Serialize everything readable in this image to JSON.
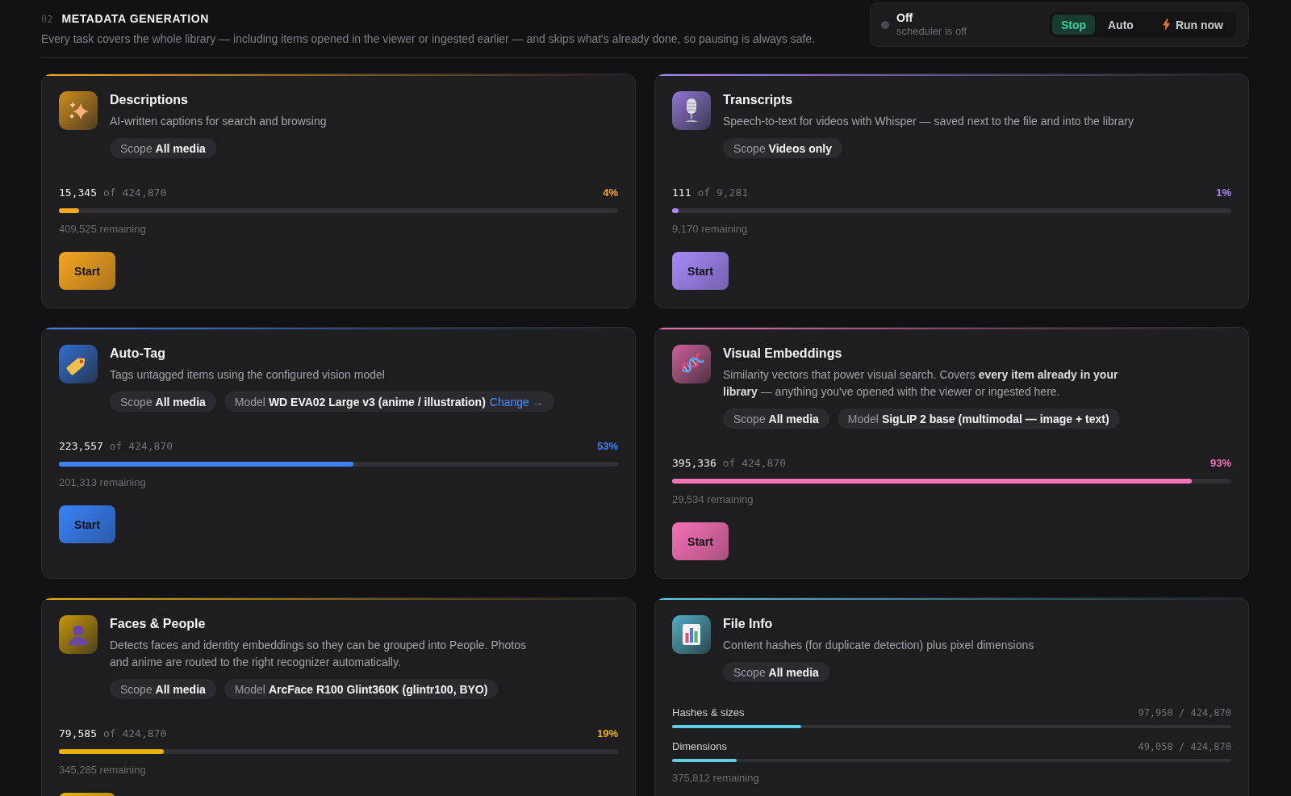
{
  "header": {
    "section_number": "02",
    "title": "METADATA GENERATION",
    "subtitle": "Every task covers the whole library — including items opened in the viewer or ingested earlier — and skips what's already done, so pausing is always safe."
  },
  "scheduler": {
    "on": false,
    "state": "Off",
    "detail": "scheduler is off",
    "modes": [
      {
        "label": "Stop",
        "selected": true
      },
      {
        "label": "Auto",
        "selected": false
      }
    ],
    "run_button": {
      "label": "Run now"
    }
  },
  "tasks": [
    {
      "kind": "progress",
      "title": "Descriptions",
      "color": "#f5a623",
      "description": "AI-written captions for search and browsing",
      "chips": [
        {
          "text": "Scope **All media**"
        }
      ],
      "progress": {
        "done": "15,345",
        "total": "of 424,870",
        "percent": "4%",
        "level": 0.036,
        "remaining": "409,525 remaining"
      },
      "button": {
        "kind": "primary",
        "label": "Start"
      }
    },
    {
      "kind": "progress",
      "title": "Transcripts",
      "color": "#a78bfa",
      "description": "Speech-to-text for videos with Whisper — saved next to the file and into the library",
      "chips": [
        {
          "text": "Scope **Videos only**"
        }
      ],
      "progress": {
        "done": "111",
        "total": "of 9,281",
        "percent": "1%",
        "level": 0.012,
        "remaining": "9,170 remaining"
      },
      "button": {
        "kind": "primary",
        "label": "Start"
      }
    },
    {
      "kind": "progress",
      "title": "Auto-Tag",
      "color": "#3b82f6",
      "description": "Tags untagged items using the configured vision model",
      "chips": [
        {
          "text": "Scope **All media**"
        },
        {
          "text": "Model **WD EVA02 Large v3 (anime / illustration)**",
          "link": "Change →"
        }
      ],
      "progress": {
        "done": "223,557",
        "total": "of 424,870",
        "percent": "53%",
        "level": 0.526,
        "remaining": "201,313 remaining"
      },
      "button": {
        "kind": "primary",
        "label": "Start"
      }
    },
    {
      "kind": "progress",
      "title": "Visual Embeddings",
      "color": "#f472b6",
      "description": "Similarity vectors that power visual search. Covers **every item already in your library** — anything you've opened with the viewer or ingested here.",
      "chips": [
        {
          "text": "Scope **All media**"
        },
        {
          "text": "Model **SigLIP 2 base (multimodal — image + text)**"
        }
      ],
      "progress": {
        "done": "395,336",
        "total": "of 424,870",
        "percent": "93%",
        "level": 0.93,
        "remaining": "29,534 remaining"
      },
      "button": {
        "kind": "primary",
        "label": "Start"
      }
    },
    {
      "kind": "progress",
      "title": "Faces & People",
      "color": "#eab308",
      "description": "Detects faces and identity embeddings so they can be grouped into People. Photos and anime are routed to the right recognizer automatically.",
      "chips": [
        {
          "text": "Scope **All media**"
        },
        {
          "text": "Model **ArcFace R100 Glint360K (glintr100, BYO)**"
        }
      ],
      "progress": {
        "done": "79,585",
        "total": "of 424,870",
        "percent": "19%",
        "level": 0.187,
        "remaining": "345,285 remaining"
      },
      "button": {
        "kind": "primary"
      }
    },
    {
      "kind": "breakdown",
      "title": "File Info",
      "color": "#5ccfe6",
      "description": "Content hashes (for duplicate detection) plus pixel dimensions",
      "chips": [
        {
          "text": "Scope **All media**"
        }
      ],
      "rows": [
        {
          "label": "Hashes & sizes",
          "count": "97,950 / 424,870",
          "level": 0.231
        },
        {
          "label": "Dimensions",
          "count": "49,058 / 424,870",
          "level": 0.115
        }
      ],
      "remaining": "375,812 remaining"
    }
  ]
}
